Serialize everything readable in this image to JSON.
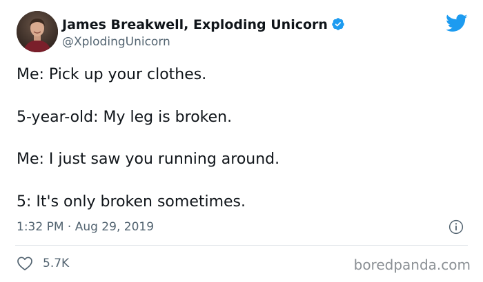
{
  "tweet": {
    "author": {
      "display_name": "James Breakwell, Exploding Unicorn",
      "handle": "@XplodingUnicorn",
      "verified": true,
      "avatar_icon": "avatar-photo"
    },
    "lines": [
      "Me: Pick up your clothes.",
      "5-year-old: My leg is broken.",
      "Me: I just saw you running around.",
      "5: It's only broken sometimes."
    ],
    "timestamp": "1:32 PM · Aug 29, 2019",
    "likes": "5.7K"
  },
  "icons": {
    "platform": "twitter-bird-icon",
    "verified": "verified-badge-icon",
    "info": "info-icon",
    "like": "heart-icon"
  },
  "colors": {
    "twitter_blue": "#1d9bf0",
    "secondary_text": "#536471",
    "primary_text": "#0f1419",
    "divider": "#d9dee2"
  },
  "watermark": "boredpanda.com"
}
